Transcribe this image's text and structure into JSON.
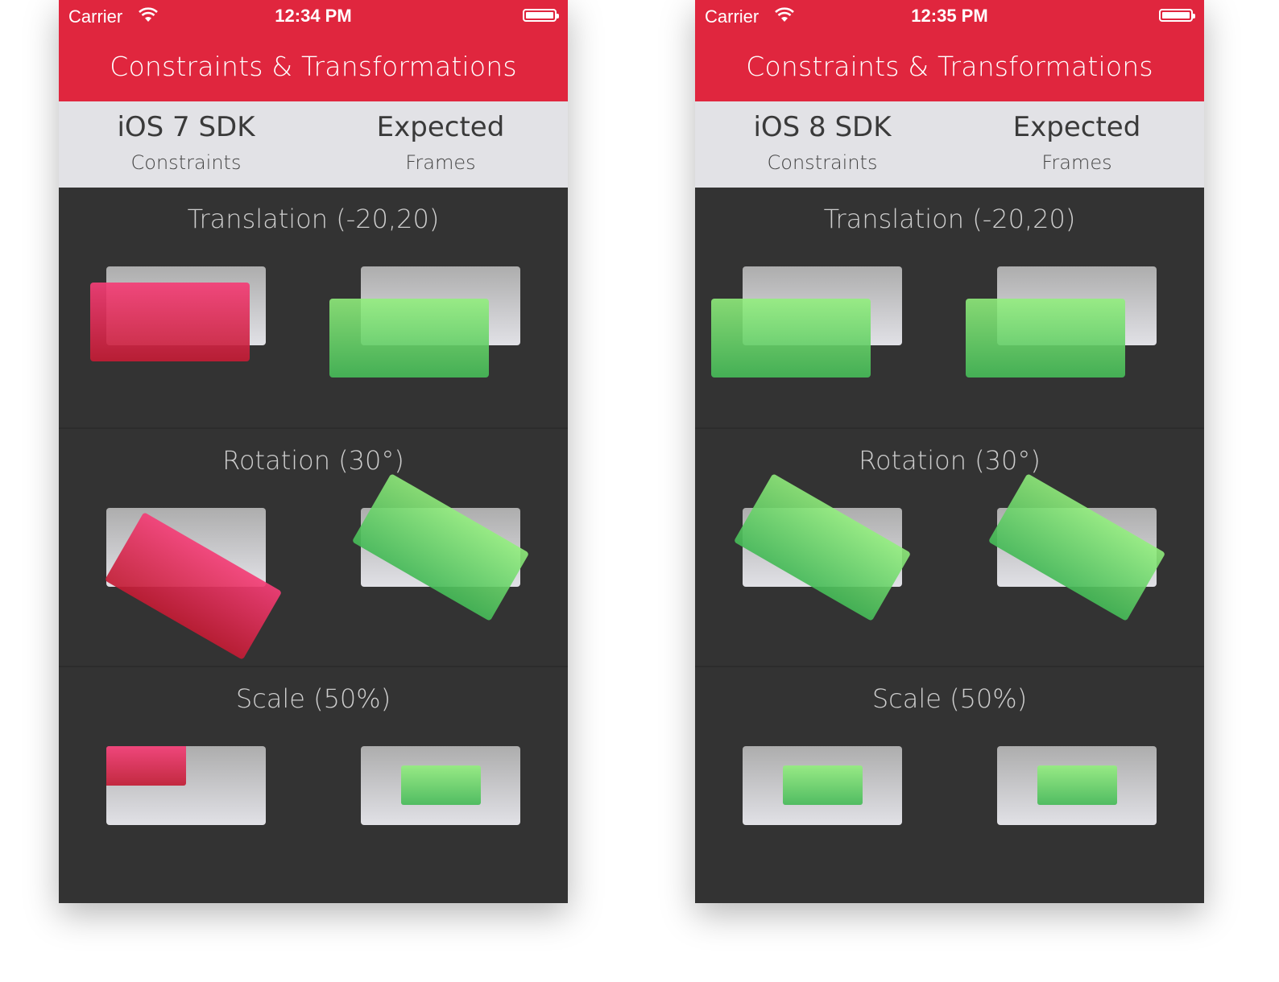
{
  "phones": [
    {
      "status_bar": {
        "carrier": "Carrier",
        "time": "12:34 PM",
        "wifi_icon": "wifi-icon",
        "battery_icon": "battery-full-icon"
      },
      "nav_title": "Constraints & Transformations",
      "columns": [
        {
          "heading": "iOS 7 SDK",
          "subheading": "Constraints"
        },
        {
          "heading": "Expected",
          "subheading": "Frames"
        }
      ],
      "sections": [
        {
          "title": "Translation (-20,20)",
          "transform": "translation",
          "left_result": "incorrect",
          "right_result": "expected"
        },
        {
          "title": "Rotation (30°)",
          "transform": "rotation",
          "left_result": "incorrect",
          "right_result": "expected"
        },
        {
          "title": "Scale (50%)",
          "transform": "scale",
          "left_result": "incorrect",
          "right_result": "expected"
        }
      ]
    },
    {
      "status_bar": {
        "carrier": "Carrier",
        "time": "12:35 PM",
        "wifi_icon": "wifi-icon",
        "battery_icon": "battery-full-icon"
      },
      "nav_title": "Constraints & Transformations",
      "columns": [
        {
          "heading": "iOS 8 SDK",
          "subheading": "Constraints"
        },
        {
          "heading": "Expected",
          "subheading": "Frames"
        }
      ],
      "sections": [
        {
          "title": "Translation (-20,20)",
          "transform": "translation",
          "left_result": "expected",
          "right_result": "expected"
        },
        {
          "title": "Rotation (30°)",
          "transform": "rotation",
          "left_result": "expected",
          "right_result": "expected"
        },
        {
          "title": "Scale (50%)",
          "transform": "scale",
          "left_result": "expected",
          "right_result": "expected"
        }
      ]
    }
  ],
  "colors": {
    "nav_red": "#e0263e",
    "header_gray": "#e2e2e6",
    "content_dark": "#333333",
    "incorrect_pink": "#f03e76",
    "expected_green": "#7be07a"
  }
}
